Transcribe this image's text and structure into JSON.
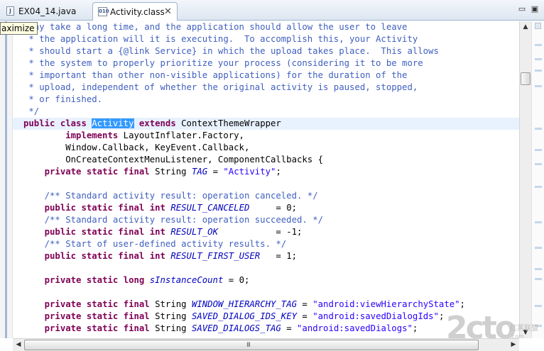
{
  "tabs": [
    {
      "label": "EX04_14.java",
      "icon": "java-file-icon",
      "active": false
    },
    {
      "label": "Activity.class",
      "icon": "class-file-icon",
      "active": true
    }
  ],
  "tooltip": "aximize",
  "watermark": {
    "main": "2cto",
    "sub": "红黑联盟",
    "url": ".com"
  },
  "code": {
    "comment_lines": [
      " may take a long time, and the application should allow the user to leave",
      " * the application will it is executing.  To accomplish this, your Activity",
      " * should start a {@link Service} in which the upload takes place.  This allows",
      " * the system to properly prioritize your process (considering it to be more",
      " * important than other non-visible applications) for the duration of the",
      " * upload, independent of whether the original activity is paused, stopped,",
      " * or finished.",
      " */"
    ],
    "kw_public": "public",
    "kw_class": "class",
    "class_name": "Activity",
    "kw_extends": "extends",
    "super_class": " ContextThemeWrapper",
    "kw_implements": "implements",
    "impl_1": " LayoutInflater.Factory,",
    "impl_2": "Window.Callback, KeyEvent.Callback,",
    "impl_3": "OnCreateContextMenuListener, ComponentCallbacks {",
    "kw_private": "private",
    "kw_static": "static",
    "kw_final": "final",
    "kw_int": "int",
    "kw_long": "long",
    "type_string": " String ",
    "tag_name": "TAG",
    "tag_value": "\"Activity\"",
    "cmt_canceled": "/** Standard activity result: operation canceled. */",
    "result_canceled": "RESULT_CANCELED",
    "result_canceled_val": "     = 0;",
    "cmt_succeeded": "/** Standard activity result: operation succeeded. */",
    "result_ok": "RESULT_OK",
    "result_ok_val": "           = -1;",
    "cmt_first_user": "/** Start of user-defined activity results. */",
    "result_first_user": "RESULT_FIRST_USER",
    "result_first_user_val": "   = 1;",
    "instance_count": "sInstanceCount",
    "instance_count_val": " = 0;",
    "window_tag": "WINDOW_HIERARCHY_TAG",
    "window_tag_val": "\"android:viewHierarchyState\"",
    "dialog_ids_key": "SAVED_DIALOG_IDS_KEY",
    "dialog_ids_val": "\"android:savedDialogIds\"",
    "dialogs_tag": "SAVED_DIALOGS_TAG",
    "dialogs_tag_val": "\"android:savedDialogs\""
  },
  "scrollbars": {
    "v_up": "▲",
    "v_down": "▼",
    "h_left": "◀",
    "h_right": "▶",
    "grip": "III"
  }
}
